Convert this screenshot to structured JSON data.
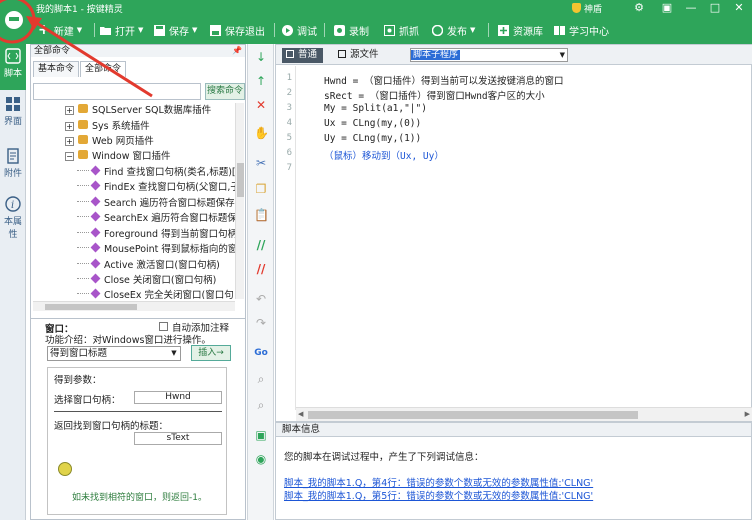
{
  "app": {
    "title": "我的脚本1 - 按键精灵",
    "user": "神盾",
    "colors": {
      "brand": "#2ea55a",
      "link": "#1d56d6",
      "highlight": "#2b6cd6",
      "annotation": "#e23a2e"
    }
  },
  "toolbar": {
    "new": "新建",
    "open": "打开",
    "save": "保存",
    "save_exit": "保存退出",
    "debug": "调试",
    "record": "录制",
    "capture": "抓抓",
    "publish": "发布",
    "resource": "资源库",
    "learn": "学习中心"
  },
  "nav": {
    "items": [
      {
        "label": "脚本",
        "icon": "script-icon"
      },
      {
        "label": "界面",
        "icon": "grid-icon"
      },
      {
        "label": "附件",
        "icon": "attachment-icon"
      },
      {
        "label": "本属性",
        "icon": "info-icon"
      }
    ]
  },
  "command_panel": {
    "header": "全部命令",
    "tabs": [
      "基本命令",
      "全部命令"
    ],
    "search_value": "",
    "search_button": "搜索命令",
    "tree": [
      {
        "label": "SQLServer SQL数据库插件",
        "kind": "plugin"
      },
      {
        "label": "Sys 系统插件",
        "kind": "plugin"
      },
      {
        "label": "Web 网页插件",
        "kind": "plugin"
      },
      {
        "label": "Window 窗口插件",
        "kind": "plugin-open"
      },
      {
        "label": "Find 查找窗口句柄(类名,标题)[",
        "kind": "cmd"
      },
      {
        "label": "FindEx 查找窗口句柄(父窗口,子",
        "kind": "cmd"
      },
      {
        "label": "Search 遍历符合窗口标题保存",
        "kind": "cmd"
      },
      {
        "label": "SearchEx 遍历符合窗口标题保",
        "kind": "cmd"
      },
      {
        "label": "Foreground 得到当前窗口句柄",
        "kind": "cmd"
      },
      {
        "label": "MousePoint 得到鼠标指向的窗",
        "kind": "cmd"
      },
      {
        "label": "Active 激活窗口(窗口句柄)",
        "kind": "cmd"
      },
      {
        "label": "Close 关闭窗口(窗口句柄)",
        "kind": "cmd"
      },
      {
        "label": "CloseEx 完全关闭窗口(窗口句",
        "kind": "cmd"
      }
    ]
  },
  "props": {
    "section_label": "窗口：",
    "auto_comment": "自动添加注释",
    "func_desc": "功能介绍：对Windows窗口进行操作。",
    "selected_func": "得到窗口标题",
    "insert_button": "插入→",
    "params_title": "得到参数：",
    "param1_label": "选择窗口句柄：",
    "param1_value": "Hwnd",
    "param2_label": "返回找到窗口句柄的标题：",
    "param2_value": "sText",
    "warning": "如未找到相符的窗口，则返回-1。"
  },
  "editor": {
    "tabs": [
      "普通",
      "源文件"
    ],
    "sub_select": "脚本子程序",
    "lines": [
      "Hwnd = （窗口插件）得到当前可以发送按键消息的窗口",
      "sRect = （窗口插件）得到窗口Hwnd客户区的大小",
      "My = Split(a1,\"|\")",
      "Ux = CLng(my,(0))",
      "Uy = CLng(my,(1))",
      "（鼠标）移动到（Ux, Uy）",
      ""
    ],
    "line_numbers": [
      "1",
      "2",
      "3",
      "4",
      "5",
      "6",
      "7"
    ]
  },
  "script_info": {
    "header": "脚本信息",
    "message": "您的脚本在调试过程中，产生了下列调试信息：",
    "errors": [
      "脚本_我的脚本1.Q，第4行：错误的参数个数或无效的参数属性值:'CLNG'",
      "脚本_我的脚本1.Q，第5行：错误的参数个数或无效的参数属性值:'CLNG'"
    ]
  }
}
